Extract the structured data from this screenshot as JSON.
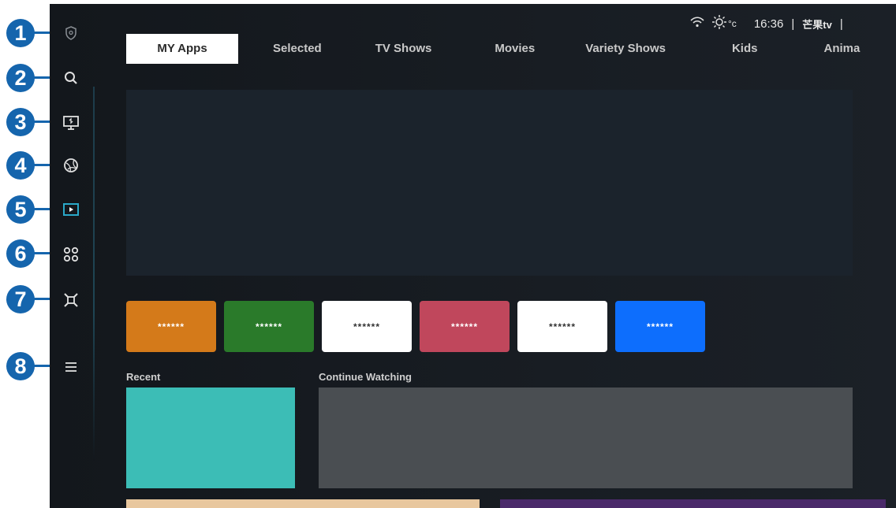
{
  "callouts": [
    "1",
    "2",
    "3",
    "4",
    "5",
    "6",
    "7",
    "8"
  ],
  "nav": {
    "items": [
      {
        "icon": "privacy-shield-icon"
      },
      {
        "icon": "search-icon"
      },
      {
        "icon": "ambient-icon"
      },
      {
        "icon": "daily-plus-icon"
      },
      {
        "icon": "media-icon"
      },
      {
        "icon": "apps-icon"
      },
      {
        "icon": "connected-devices-icon"
      },
      {
        "icon": "menu-icon"
      }
    ]
  },
  "status": {
    "temp_unit": "°c",
    "time": "16:36",
    "separator": "|",
    "logo": "芒果tv"
  },
  "tabs": [
    {
      "label": "MY Apps",
      "active": true
    },
    {
      "label": "Selected"
    },
    {
      "label": "TV Shows"
    },
    {
      "label": "Movies"
    },
    {
      "label": "Variety Shows"
    },
    {
      "label": "Kids"
    },
    {
      "label": "Anima"
    }
  ],
  "apps": [
    {
      "label": "******",
      "bg": "#d47a1a",
      "fg": "#ffffff"
    },
    {
      "label": "******",
      "bg": "#2a7a2a",
      "fg": "#ffffff"
    },
    {
      "label": "******",
      "bg": "#ffffff",
      "fg": "#333333"
    },
    {
      "label": "******",
      "bg": "#c0475c",
      "fg": "#ffffff"
    },
    {
      "label": "******",
      "bg": "#ffffff",
      "fg": "#333333"
    },
    {
      "label": "******",
      "bg": "#0d6efd",
      "fg": "#ffffff"
    }
  ],
  "sections": {
    "recent": "Recent",
    "continue_watching": "Continue Watching"
  },
  "colors": {
    "callout": "#1565ad",
    "accent": "#2aa8c8",
    "screen_bg": "#13171c"
  }
}
